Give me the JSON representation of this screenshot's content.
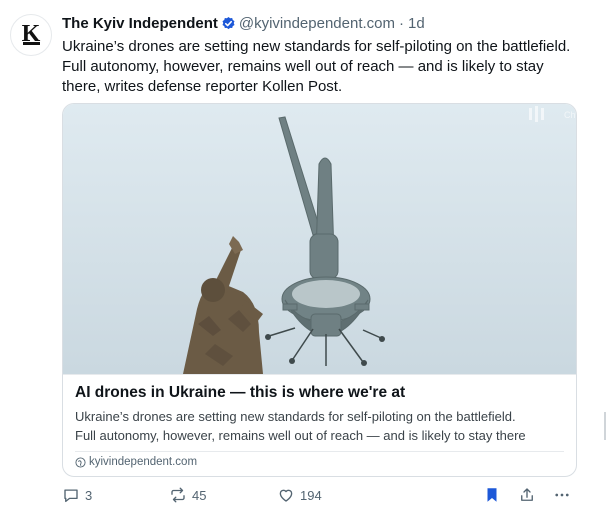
{
  "post": {
    "author": {
      "name": "The Kyiv Independent",
      "handle": "@kyivindependent.com",
      "avatar_letter": "K"
    },
    "separator": "·",
    "time": "1d",
    "text": "Ukraine’s drones are setting new standards for self-piloting on the battlefield. Full autonomy, however, remains well out of reach — and is likely to stay there, writes defense reporter Kollen Post.",
    "card": {
      "title": "AI drones in Ukraine — this is where we're at",
      "description_line1": "Ukraine’s drones are setting new standards for self-piloting on the battlefield.",
      "description_line2": "Full autonomy, however, remains well out of reach — and is likely to stay there",
      "source": "kyivindependent.com",
      "image_description_icon": "photo of a soldier launching a fixed-wing drone"
    },
    "actions": {
      "replies": "3",
      "reposts": "45",
      "likes": "194"
    }
  },
  "colors": {
    "text": "#0f1419",
    "muted": "#536471",
    "accent": "#1d58d8",
    "border": "#d9dee3"
  }
}
